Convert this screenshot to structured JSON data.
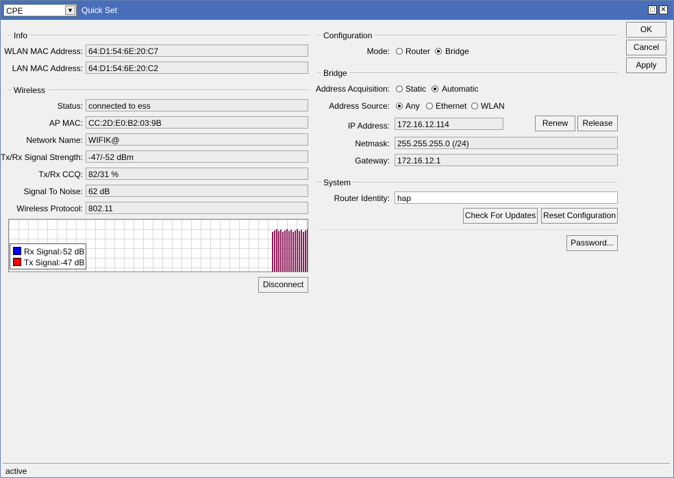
{
  "mode_combo": {
    "value": "CPE"
  },
  "window": {
    "title": "Quick Set"
  },
  "info": {
    "group_label": "Info",
    "wlan_mac_label": "WLAN MAC Address:",
    "wlan_mac": "64:D1:54:6E:20:C7",
    "lan_mac_label": "LAN MAC Address:",
    "lan_mac": "64:D1:54:6E:20:C2"
  },
  "wireless": {
    "group_label": "Wireless",
    "status_label": "Status:",
    "status": "connected to ess",
    "ap_mac_label": "AP MAC:",
    "ap_mac": "CC:2D:E0:B2:03:9B",
    "network_name_label": "Network Name:",
    "network_name": "WIFIK@",
    "signal_strength_label": "Tx/Rx Signal Strength:",
    "signal_strength": "-47/-52 dBm",
    "ccq_label": "Tx/Rx CCQ:",
    "ccq": "82/31 %",
    "snr_label": "Signal To Noise:",
    "snr": "62 dB",
    "protocol_label": "Wireless Protocol:",
    "protocol": "802.11",
    "legend": {
      "rx_label": "Rx Signal:",
      "rx_value": "-52 dB",
      "rx_color": "#0000ff",
      "tx_label": "Tx Signal:",
      "tx_value": "-47 dB",
      "tx_color": "#ff0000"
    },
    "disconnect_label": "Disconnect"
  },
  "configuration": {
    "group_label": "Configuration",
    "mode_label": "Mode:",
    "mode_options": [
      "Router",
      "Bridge"
    ],
    "mode_selected": "Bridge"
  },
  "bridge": {
    "group_label": "Bridge",
    "acquisition_label": "Address Acquisition:",
    "acquisition_options": [
      "Static",
      "Automatic"
    ],
    "acquisition_selected": "Automatic",
    "source_label": "Address Source:",
    "source_options": [
      "Any",
      "Ethernet",
      "WLAN"
    ],
    "source_selected": "Any",
    "ip_label": "IP Address:",
    "ip": "172.16.12.114",
    "renew_label": "Renew",
    "release_label": "Release",
    "netmask_label": "Netmask:",
    "netmask": "255.255.255.0 (/24)",
    "gateway_label": "Gateway:",
    "gateway": "172.16.12.1"
  },
  "system": {
    "group_label": "System",
    "identity_label": "Router Identity:",
    "identity": "hap",
    "check_updates_label": "Check For Updates",
    "reset_config_label": "Reset Configuration",
    "password_label": "Password..."
  },
  "actions": {
    "ok": "OK",
    "cancel": "Cancel",
    "apply": "Apply"
  },
  "status_bar": {
    "text": "active"
  },
  "colors": {
    "titlebar": "#4a6fba",
    "graph_bars": "#8b1a5a"
  }
}
